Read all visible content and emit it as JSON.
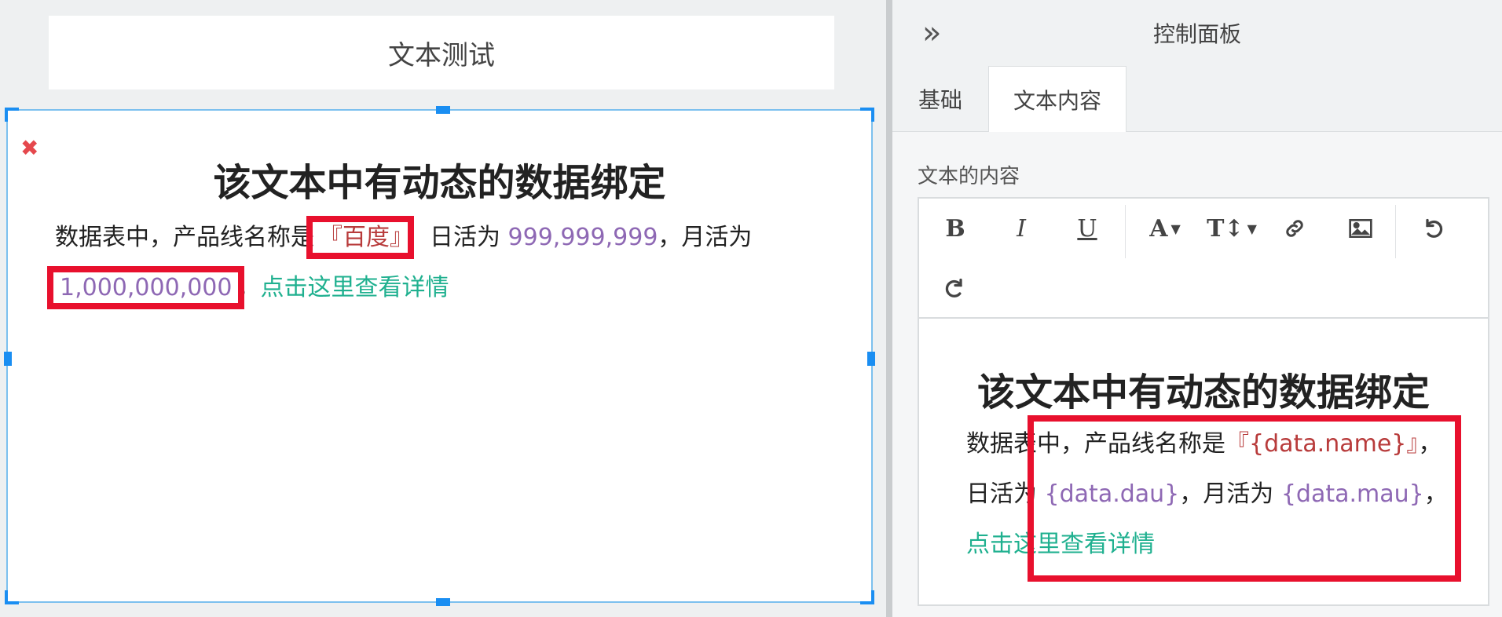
{
  "canvas": {
    "title": "文本测试",
    "delete_icon": "close-icon",
    "heading": "该文本中有动态的数据绑定",
    "body": {
      "prefix": "数据表中，产品线名称是",
      "name_value": "『百度』",
      "sep1": "，日活为 ",
      "dau_value": "999,999,999",
      "sep2": "，月活为 ",
      "mau_value": "1,000,000,000",
      "sep3": "，",
      "link_text": "点击这里查看详情"
    }
  },
  "panel": {
    "title": "控制面板",
    "collapse_icon": "double-chevron-right-icon",
    "tabs": [
      {
        "label": "基础",
        "active": false
      },
      {
        "label": "文本内容",
        "active": true
      }
    ],
    "section_label": "文本的内容",
    "toolbar": {
      "buttons": [
        "bold",
        "italic",
        "underline",
        "font-color",
        "font-size",
        "link",
        "image",
        "undo",
        "redo"
      ],
      "bold_glyph": "B",
      "italic_glyph": "I",
      "underline_glyph": "U",
      "font_color_glyph": "A",
      "font_size_glyph": "T↕"
    },
    "editor": {
      "heading": "该文本中有动态的数据绑定",
      "prefix": "数据表中，产品线名称是",
      "name_tpl": "『{data.name}』",
      "sep1": "，日活为 ",
      "dau_tpl": "{data.dau}",
      "sep2": "，月活为 ",
      "mau_tpl": "{data.mau}",
      "sep3": "，",
      "link_text": "点击这里查看详情"
    }
  },
  "colors": {
    "selection": "#1a8ef2",
    "highlight": "#e8102d",
    "name": "#b83b3b",
    "number": "#8e68b4",
    "link": "#1fb08f"
  }
}
